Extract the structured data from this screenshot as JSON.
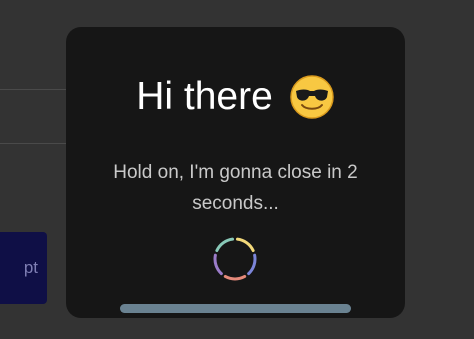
{
  "background": {
    "button_label": "pt",
    "colors": {
      "page": "#333333",
      "button": "#0f0f46"
    }
  },
  "dialog": {
    "title": "Hi there",
    "title_emoji": "smiling-face-with-sunglasses-icon",
    "message": "Hold on, I'm gonna close in 2 seconds...",
    "spinner_icon": "loading-spinner-icon",
    "progress": 1.0,
    "colors": {
      "surface": "#161616",
      "title": "#ffffff",
      "message": "#c9c9c9",
      "progress": "#6a8291",
      "spinner": [
        "#f3d97a",
        "#7c85d9",
        "#e58a7a",
        "#9b7cc9",
        "#89c9b8"
      ]
    }
  }
}
